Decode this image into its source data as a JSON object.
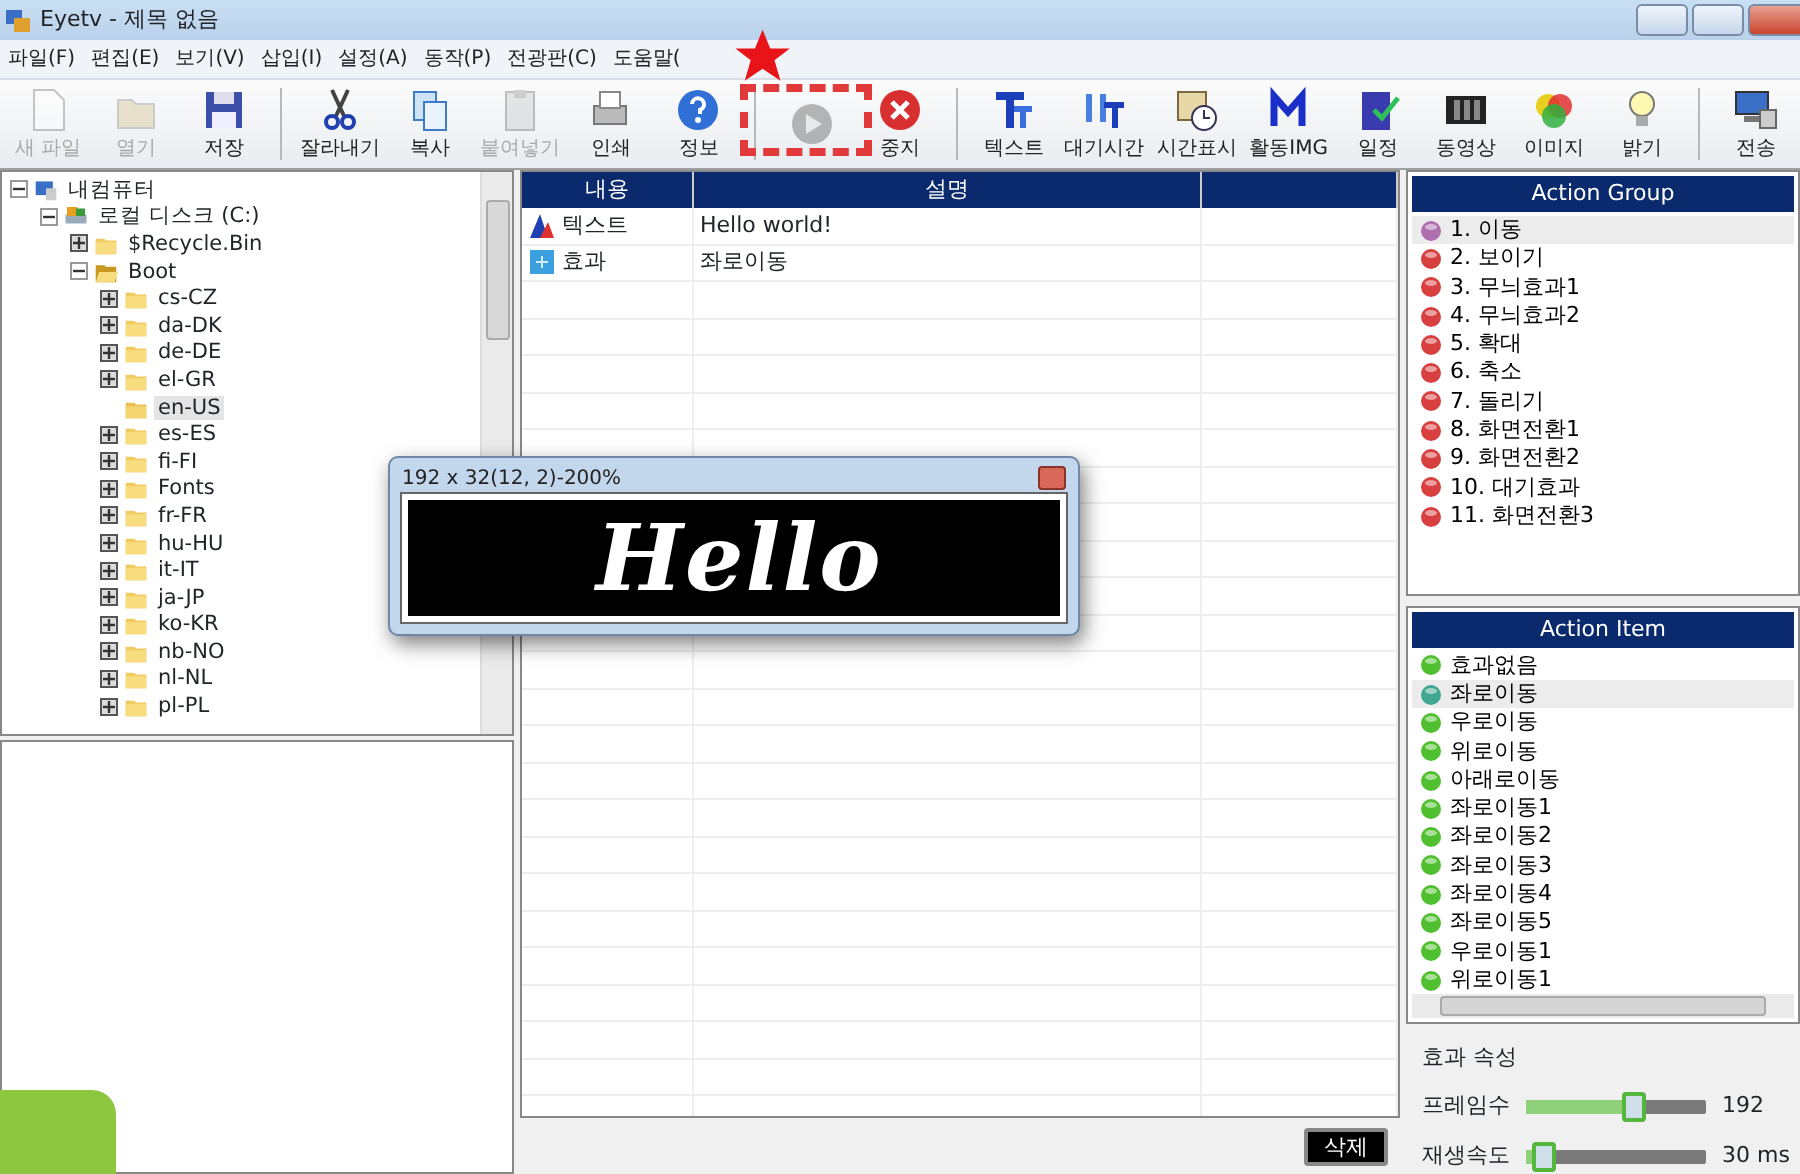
{
  "window": {
    "title": "Eyetv - 제목 없음"
  },
  "menu": [
    "파일(F)",
    "편집(E)",
    "보기(V)",
    "삽입(I)",
    "설정(A)",
    "동작(P)",
    "전광판(C)",
    "도움말("
  ],
  "toolbar": [
    {
      "kind": "new",
      "label": "새 파일",
      "disabled": true
    },
    {
      "kind": "open",
      "label": "열기",
      "disabled": true
    },
    {
      "kind": "save",
      "label": "저장",
      "disabled": false
    },
    {
      "kind": "separator"
    },
    {
      "kind": "cut",
      "label": "잘라내기",
      "disabled": false
    },
    {
      "kind": "copy",
      "label": "복사",
      "disabled": false
    },
    {
      "kind": "paste",
      "label": "붙여넣기",
      "disabled": true
    },
    {
      "kind": "print",
      "label": "인쇄",
      "disabled": false
    },
    {
      "kind": "info",
      "label": "정보",
      "disabled": false
    },
    {
      "kind": "separator"
    },
    {
      "kind": "play",
      "disabled": true
    },
    {
      "kind": "stop",
      "label": "중지",
      "disabled": false
    },
    {
      "kind": "separator"
    },
    {
      "kind": "text",
      "label": "텍스트",
      "disabled": false
    },
    {
      "kind": "wait",
      "label": "대기시간",
      "disabled": false
    },
    {
      "kind": "clock",
      "label": "시간표시",
      "disabled": false
    },
    {
      "kind": "activity",
      "label": "활동IMG",
      "disabled": false
    },
    {
      "kind": "schedule",
      "label": "일정",
      "disabled": false
    },
    {
      "kind": "video",
      "label": "동영상",
      "disabled": false
    },
    {
      "kind": "image",
      "label": "이미지",
      "disabled": false
    },
    {
      "kind": "light",
      "label": "밝기",
      "disabled": false
    },
    {
      "kind": "separator"
    },
    {
      "kind": "send",
      "label": "전송",
      "disabled": false
    }
  ],
  "tree": [
    {
      "label": "내컴퓨터",
      "kind": "computer",
      "expanded": true,
      "selected": false,
      "children": [
        {
          "label": "로컬 디스크 (C:)",
          "kind": "drive",
          "expanded": true,
          "selected": false,
          "children": [
            {
              "label": "$Recycle.Bin",
              "kind": "folder",
              "selected": false
            },
            {
              "label": "Boot",
              "kind": "folder",
              "expanded": true,
              "selected": false,
              "children": [
                {
                  "label": "cs-CZ",
                  "kind": "folder",
                  "selected": false
                },
                {
                  "label": "da-DK",
                  "kind": "folder",
                  "selected": false
                },
                {
                  "label": "de-DE",
                  "kind": "folder",
                  "selected": false
                },
                {
                  "label": "el-GR",
                  "kind": "folder",
                  "selected": false
                },
                {
                  "label": "en-US",
                  "kind": "leaf",
                  "selected": true
                },
                {
                  "label": "es-ES",
                  "kind": "folder",
                  "selected": false
                },
                {
                  "label": "fi-FI",
                  "kind": "folder",
                  "selected": false
                },
                {
                  "label": "Fonts",
                  "kind": "folder",
                  "selected": false
                },
                {
                  "label": "fr-FR",
                  "kind": "folder",
                  "selected": false
                },
                {
                  "label": "hu-HU",
                  "kind": "folder",
                  "selected": false
                },
                {
                  "label": "it-IT",
                  "kind": "folder",
                  "selected": false
                },
                {
                  "label": "ja-JP",
                  "kind": "folder",
                  "selected": false
                },
                {
                  "label": "ko-KR",
                  "kind": "folder",
                  "selected": false
                },
                {
                  "label": "nb-NO",
                  "kind": "folder",
                  "selected": false
                },
                {
                  "label": "nl-NL",
                  "kind": "folder",
                  "selected": false
                },
                {
                  "label": "pl-PL",
                  "kind": "folder",
                  "selected": false
                }
              ]
            }
          ]
        }
      ]
    }
  ],
  "table": {
    "columns": [
      "내용",
      "설명"
    ],
    "rows": [
      {
        "kind": "text",
        "cells": [
          "텍스트",
          "Hello world!"
        ]
      },
      {
        "kind": "effect",
        "cells": [
          "효과",
          "좌로이동"
        ]
      }
    ]
  },
  "preview": {
    "title": "192 x 32(12, 2)-200%",
    "text": "Hello"
  },
  "delete_button": "삭제",
  "action_group": {
    "title": "Action Group",
    "items": [
      {
        "label": "1. 이동",
        "selected": true
      },
      {
        "label": "2. 보이기",
        "selected": false
      },
      {
        "label": "3. 무늬효과1",
        "selected": false
      },
      {
        "label": "4. 무늬효과2",
        "selected": false
      },
      {
        "label": "5. 확대",
        "selected": false
      },
      {
        "label": "6. 축소",
        "selected": false
      },
      {
        "label": "7. 돌리기",
        "selected": false
      },
      {
        "label": "8. 화면전환1",
        "selected": false
      },
      {
        "label": "9. 화면전환2",
        "selected": false
      },
      {
        "label": "10. 대기효과",
        "selected": false
      },
      {
        "label": "11. 화면전환3",
        "selected": false
      }
    ]
  },
  "action_item": {
    "title": "Action Item",
    "items": [
      {
        "label": "효과없음",
        "selected": false
      },
      {
        "label": "좌로이동",
        "selected": true
      },
      {
        "label": "우로이동",
        "selected": false
      },
      {
        "label": "위로이동",
        "selected": false
      },
      {
        "label": "아래로이동",
        "selected": false
      },
      {
        "label": "좌로이동1",
        "selected": false
      },
      {
        "label": "좌로이동2",
        "selected": false
      },
      {
        "label": "좌로이동3",
        "selected": false
      },
      {
        "label": "좌로이동4",
        "selected": false
      },
      {
        "label": "좌로이동5",
        "selected": false
      },
      {
        "label": "우로이동1",
        "selected": false
      },
      {
        "label": "위로이동1",
        "selected": false
      }
    ]
  },
  "effect_properties": {
    "title": "효과 속성",
    "sliders": [
      {
        "label": "프레임수",
        "level": 0.6,
        "reading": "192"
      },
      {
        "label": "재생속도",
        "level": 0.1,
        "reading": "30 ms"
      }
    ]
  }
}
